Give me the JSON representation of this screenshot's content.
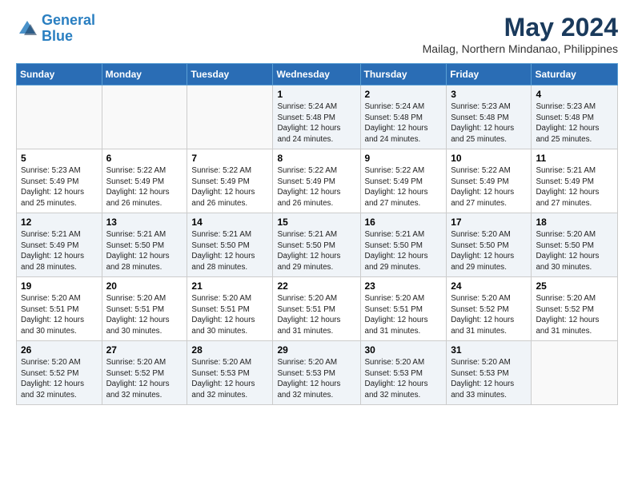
{
  "logo": {
    "line1": "General",
    "line2": "Blue"
  },
  "title": "May 2024",
  "subtitle": "Mailag, Northern Mindanao, Philippines",
  "weekdays": [
    "Sunday",
    "Monday",
    "Tuesday",
    "Wednesday",
    "Thursday",
    "Friday",
    "Saturday"
  ],
  "weeks": [
    [
      {
        "day": "",
        "info": ""
      },
      {
        "day": "",
        "info": ""
      },
      {
        "day": "",
        "info": ""
      },
      {
        "day": "1",
        "info": "Sunrise: 5:24 AM\nSunset: 5:48 PM\nDaylight: 12 hours\nand 24 minutes."
      },
      {
        "day": "2",
        "info": "Sunrise: 5:24 AM\nSunset: 5:48 PM\nDaylight: 12 hours\nand 24 minutes."
      },
      {
        "day": "3",
        "info": "Sunrise: 5:23 AM\nSunset: 5:48 PM\nDaylight: 12 hours\nand 25 minutes."
      },
      {
        "day": "4",
        "info": "Sunrise: 5:23 AM\nSunset: 5:48 PM\nDaylight: 12 hours\nand 25 minutes."
      }
    ],
    [
      {
        "day": "5",
        "info": "Sunrise: 5:23 AM\nSunset: 5:49 PM\nDaylight: 12 hours\nand 25 minutes."
      },
      {
        "day": "6",
        "info": "Sunrise: 5:22 AM\nSunset: 5:49 PM\nDaylight: 12 hours\nand 26 minutes."
      },
      {
        "day": "7",
        "info": "Sunrise: 5:22 AM\nSunset: 5:49 PM\nDaylight: 12 hours\nand 26 minutes."
      },
      {
        "day": "8",
        "info": "Sunrise: 5:22 AM\nSunset: 5:49 PM\nDaylight: 12 hours\nand 26 minutes."
      },
      {
        "day": "9",
        "info": "Sunrise: 5:22 AM\nSunset: 5:49 PM\nDaylight: 12 hours\nand 27 minutes."
      },
      {
        "day": "10",
        "info": "Sunrise: 5:22 AM\nSunset: 5:49 PM\nDaylight: 12 hours\nand 27 minutes."
      },
      {
        "day": "11",
        "info": "Sunrise: 5:21 AM\nSunset: 5:49 PM\nDaylight: 12 hours\nand 27 minutes."
      }
    ],
    [
      {
        "day": "12",
        "info": "Sunrise: 5:21 AM\nSunset: 5:49 PM\nDaylight: 12 hours\nand 28 minutes."
      },
      {
        "day": "13",
        "info": "Sunrise: 5:21 AM\nSunset: 5:50 PM\nDaylight: 12 hours\nand 28 minutes."
      },
      {
        "day": "14",
        "info": "Sunrise: 5:21 AM\nSunset: 5:50 PM\nDaylight: 12 hours\nand 28 minutes."
      },
      {
        "day": "15",
        "info": "Sunrise: 5:21 AM\nSunset: 5:50 PM\nDaylight: 12 hours\nand 29 minutes."
      },
      {
        "day": "16",
        "info": "Sunrise: 5:21 AM\nSunset: 5:50 PM\nDaylight: 12 hours\nand 29 minutes."
      },
      {
        "day": "17",
        "info": "Sunrise: 5:20 AM\nSunset: 5:50 PM\nDaylight: 12 hours\nand 29 minutes."
      },
      {
        "day": "18",
        "info": "Sunrise: 5:20 AM\nSunset: 5:50 PM\nDaylight: 12 hours\nand 30 minutes."
      }
    ],
    [
      {
        "day": "19",
        "info": "Sunrise: 5:20 AM\nSunset: 5:51 PM\nDaylight: 12 hours\nand 30 minutes."
      },
      {
        "day": "20",
        "info": "Sunrise: 5:20 AM\nSunset: 5:51 PM\nDaylight: 12 hours\nand 30 minutes."
      },
      {
        "day": "21",
        "info": "Sunrise: 5:20 AM\nSunset: 5:51 PM\nDaylight: 12 hours\nand 30 minutes."
      },
      {
        "day": "22",
        "info": "Sunrise: 5:20 AM\nSunset: 5:51 PM\nDaylight: 12 hours\nand 31 minutes."
      },
      {
        "day": "23",
        "info": "Sunrise: 5:20 AM\nSunset: 5:51 PM\nDaylight: 12 hours\nand 31 minutes."
      },
      {
        "day": "24",
        "info": "Sunrise: 5:20 AM\nSunset: 5:52 PM\nDaylight: 12 hours\nand 31 minutes."
      },
      {
        "day": "25",
        "info": "Sunrise: 5:20 AM\nSunset: 5:52 PM\nDaylight: 12 hours\nand 31 minutes."
      }
    ],
    [
      {
        "day": "26",
        "info": "Sunrise: 5:20 AM\nSunset: 5:52 PM\nDaylight: 12 hours\nand 32 minutes."
      },
      {
        "day": "27",
        "info": "Sunrise: 5:20 AM\nSunset: 5:52 PM\nDaylight: 12 hours\nand 32 minutes."
      },
      {
        "day": "28",
        "info": "Sunrise: 5:20 AM\nSunset: 5:53 PM\nDaylight: 12 hours\nand 32 minutes."
      },
      {
        "day": "29",
        "info": "Sunrise: 5:20 AM\nSunset: 5:53 PM\nDaylight: 12 hours\nand 32 minutes."
      },
      {
        "day": "30",
        "info": "Sunrise: 5:20 AM\nSunset: 5:53 PM\nDaylight: 12 hours\nand 32 minutes."
      },
      {
        "day": "31",
        "info": "Sunrise: 5:20 AM\nSunset: 5:53 PM\nDaylight: 12 hours\nand 33 minutes."
      },
      {
        "day": "",
        "info": ""
      }
    ]
  ]
}
